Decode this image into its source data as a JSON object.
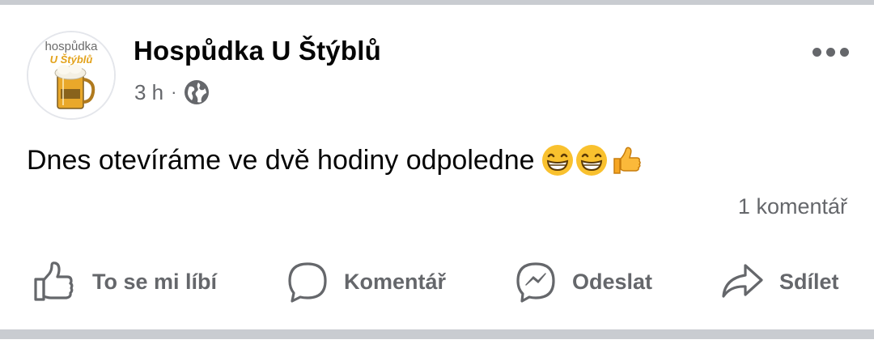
{
  "post": {
    "author": "Hospůdka U Štýblů",
    "avatar_text_line1": "hospůdka",
    "avatar_text_line2": "U Štýblů",
    "time": "3 h",
    "separator": "·",
    "privacy_icon": "globe-icon",
    "text": "Dnes otevíráme ve dvě hodiny odpoledne",
    "emojis": [
      "grinning-face-with-smiling-eyes",
      "grinning-face-with-smiling-eyes",
      "thumbs-up"
    ],
    "comments_count": "1 komentář"
  },
  "actions": {
    "like": {
      "label": "To se mi líbí",
      "icon": "thumbs-up-icon"
    },
    "comment": {
      "label": "Komentář",
      "icon": "speech-bubble-icon"
    },
    "send": {
      "label": "Odeslat",
      "icon": "messenger-icon"
    },
    "share": {
      "label": "Sdílet",
      "icon": "share-arrow-icon"
    }
  },
  "colors": {
    "secondary_text": "#65676b",
    "primary_text": "#050505",
    "separator": "#c9ccd1"
  }
}
